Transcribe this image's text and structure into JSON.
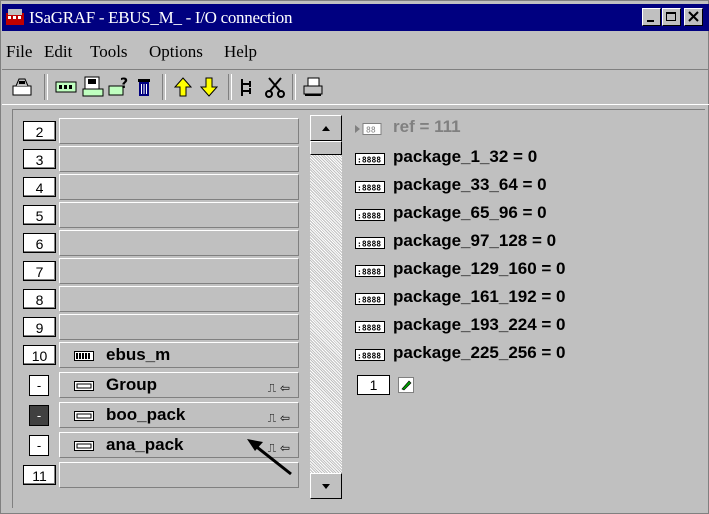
{
  "window": {
    "title": "ISaGRAF - EBUS_M_ - I/O connection"
  },
  "menu": [
    "File",
    "Edit",
    "Tools",
    "Options",
    "Help"
  ],
  "slots": [
    {
      "num": "2",
      "label": ""
    },
    {
      "num": "3",
      "label": ""
    },
    {
      "num": "4",
      "label": ""
    },
    {
      "num": "5",
      "label": ""
    },
    {
      "num": "6",
      "label": ""
    },
    {
      "num": "7",
      "label": ""
    },
    {
      "num": "8",
      "label": ""
    },
    {
      "num": "9",
      "label": ""
    },
    {
      "num": "10",
      "label": "ebus_m"
    },
    {
      "num": "-",
      "label": "Group"
    },
    {
      "num": "-",
      "label": "boo_pack"
    },
    {
      "num": "-",
      "label": "ana_pack"
    },
    {
      "num": "11",
      "label": ""
    }
  ],
  "variables": [
    {
      "text": "ref = 111"
    },
    {
      "text": "package_1_32 = 0"
    },
    {
      "text": "package_33_64 = 0"
    },
    {
      "text": "package_65_96 = 0"
    },
    {
      "text": "package_97_128 = 0"
    },
    {
      "text": "package_129_160 = 0"
    },
    {
      "text": "package_161_192 = 0"
    },
    {
      "text": "package_193_224 = 0"
    },
    {
      "text": "package_225_256 = 0"
    }
  ],
  "channel_index": "1",
  "colors": {
    "titlebar": "#000080",
    "face": "#c0c0c0",
    "disabled_text": "#808080"
  }
}
